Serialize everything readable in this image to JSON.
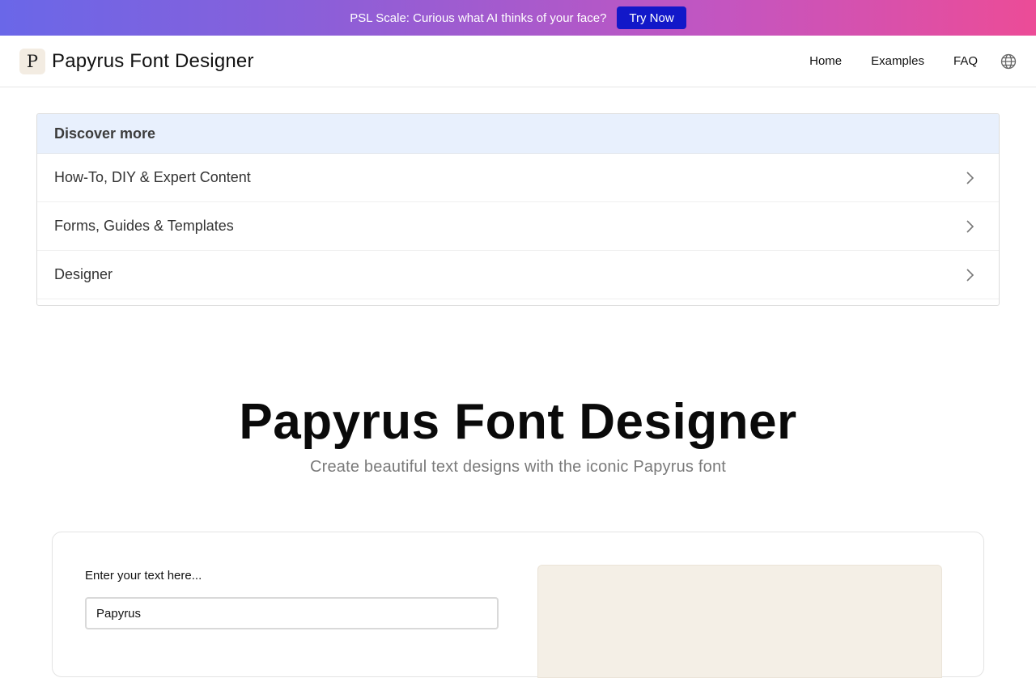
{
  "promo": {
    "text": "PSL Scale: Curious what AI thinks of your face?",
    "button_label": "Try Now"
  },
  "header": {
    "logo_letter": "P",
    "title": "Papyrus Font Designer",
    "nav": [
      {
        "label": "Home"
      },
      {
        "label": "Examples"
      },
      {
        "label": "FAQ"
      }
    ],
    "language_icon": "globe-icon"
  },
  "discover": {
    "heading": "Discover more",
    "items": [
      {
        "label": "How-To, DIY & Expert Content"
      },
      {
        "label": "Forms, Guides & Templates"
      },
      {
        "label": "Designer"
      }
    ],
    "item_icon": "chevron-right-icon"
  },
  "hero": {
    "title": "Papyrus Font Designer",
    "subtitle": "Create beautiful text designs with the iconic Papyrus font"
  },
  "editor": {
    "input_label": "Enter your text here...",
    "input_value": "Papyrus"
  },
  "colors": {
    "banner_gradient_start": "#6a67e8",
    "banner_gradient_end": "#ec4c97",
    "cta_button": "#1218c9",
    "discover_header_bg": "#e8f0fd",
    "preview_bg": "#f4efe6"
  }
}
